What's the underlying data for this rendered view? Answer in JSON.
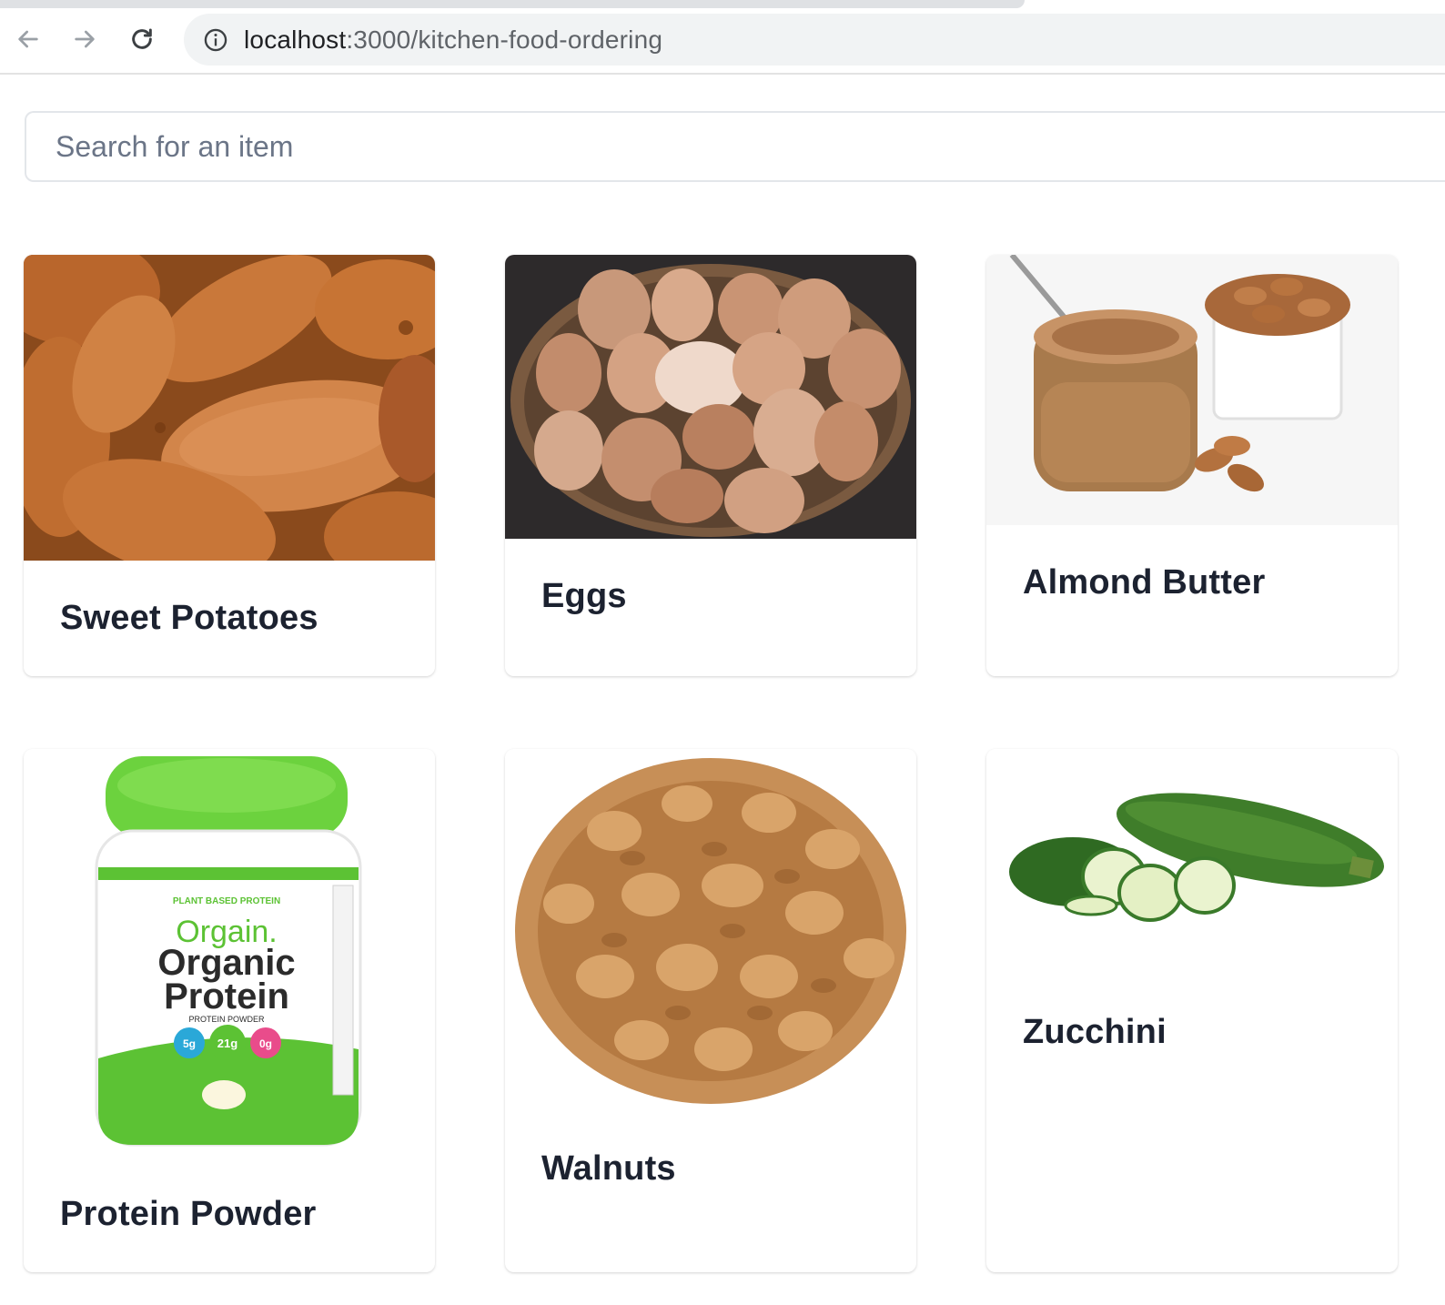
{
  "browser": {
    "url_host": "localhost",
    "url_path": ":3000/kitchen-food-ordering"
  },
  "search": {
    "placeholder": "Search for an item"
  },
  "items": [
    {
      "name": "Sweet Potatoes",
      "image": "sweet-potatoes-photo"
    },
    {
      "name": "Eggs",
      "image": "eggs-basket-photo"
    },
    {
      "name": "Almond Butter",
      "image": "almond-butter-jar-photo"
    },
    {
      "name": "Protein Powder",
      "image": "protein-powder-tub-photo"
    },
    {
      "name": "Walnuts",
      "image": "walnuts-pile-photo"
    },
    {
      "name": "Zucchini",
      "image": "zucchini-photo"
    }
  ],
  "protein_tub_label": {
    "brand": "Orgain.",
    "line1": "Organic",
    "line2": "Protein",
    "sub": "PROTEIN POWDER",
    "top": "PLANT BASED PROTEIN",
    "badges": [
      "5g",
      "21g",
      "0g"
    ]
  }
}
